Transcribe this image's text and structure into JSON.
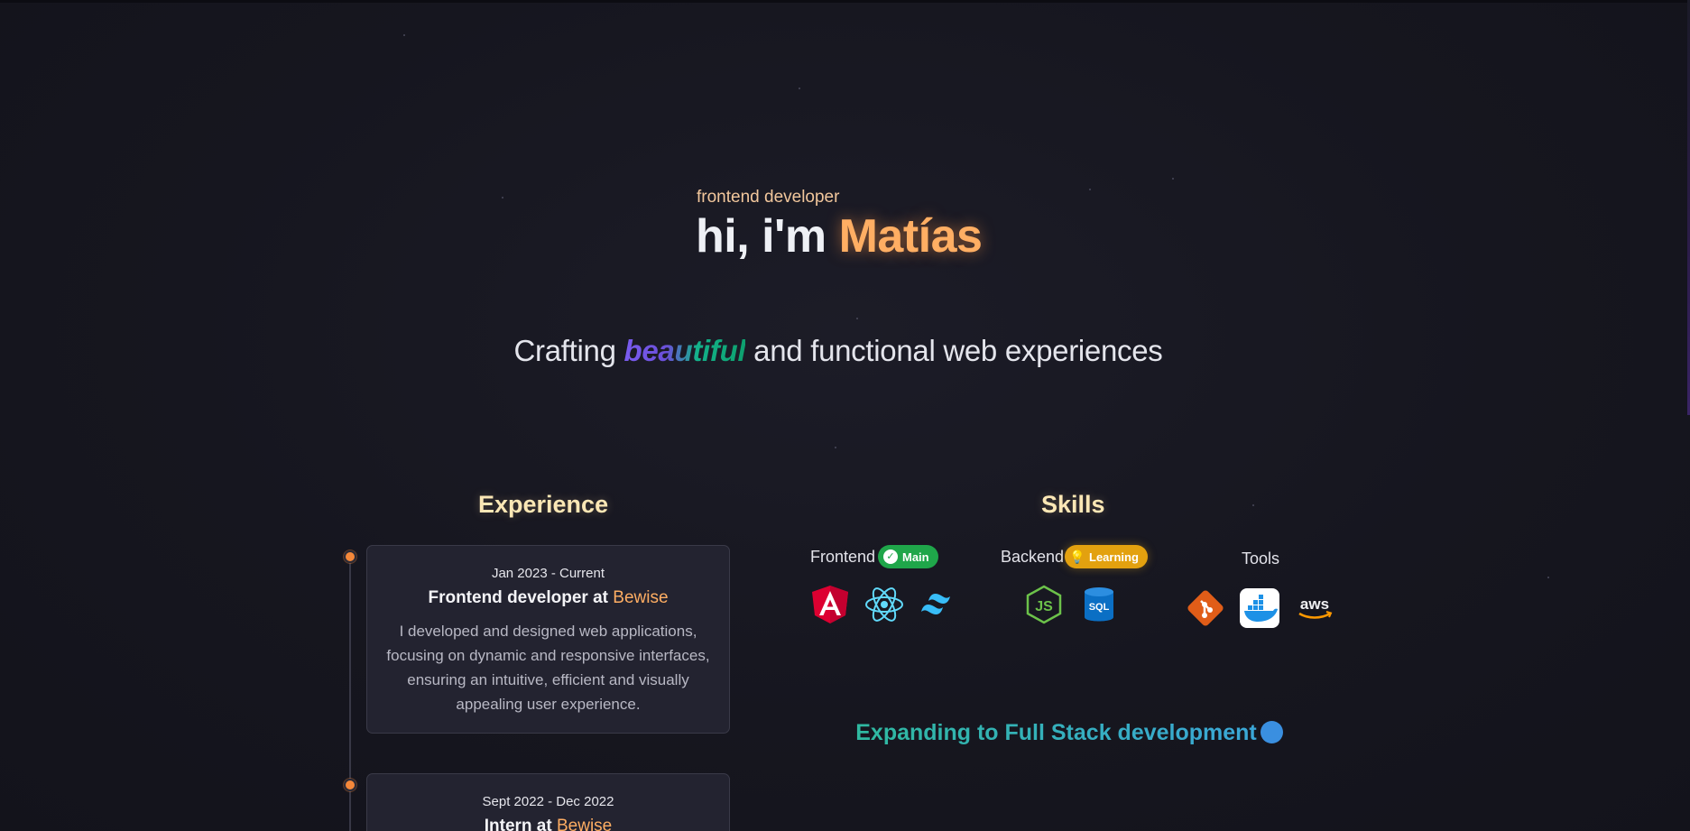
{
  "hero": {
    "tag": "frontend developer",
    "greeting": "hi, i'm ",
    "name": "Matías"
  },
  "tagline": {
    "before": "Crafting ",
    "highlight": "beautiful",
    "after": " and functional web experiences"
  },
  "experience": {
    "title": "Experience",
    "items": [
      {
        "date": "Jan 2023 - Current",
        "role": "Frontend developer at ",
        "company": "Bewise",
        "description": "I developed and designed web applications, focusing on dynamic and responsive interfaces, ensuring an intuitive, efficient and visually appealing user experience."
      },
      {
        "date": "Sept 2022 - Dec 2022",
        "role": "Intern at ",
        "company": "Bewise"
      }
    ]
  },
  "skills": {
    "title": "Skills",
    "groups": [
      {
        "label": "Frontend",
        "badge": "Main",
        "icons": [
          "angular-icon",
          "react-icon",
          "tailwind-icon"
        ]
      },
      {
        "label": "Backend",
        "badge": "Learning",
        "icons": [
          "nodejs-icon",
          "sql-database-icon"
        ]
      },
      {
        "label": "Tools",
        "icons": [
          "git-icon",
          "docker-icon",
          "aws-icon"
        ]
      }
    ],
    "expanding": "Expanding to Full Stack development"
  },
  "colors": {
    "accent": "#ffae63",
    "section_title": "#fbe7b5",
    "badge_main": "#1fa64a",
    "badge_learning": "#e3a10f",
    "timeline_dot": "#f5883a"
  }
}
